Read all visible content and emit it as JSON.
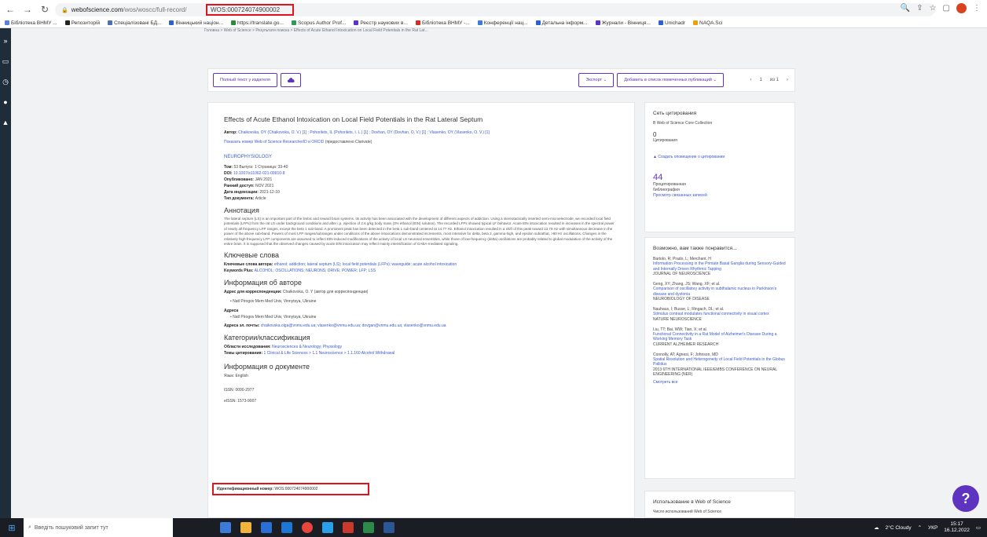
{
  "browser": {
    "url_host": "webofscience.com",
    "url_rest": "/wos/woscc/full-record/",
    "url_highlight": "WOS:000724074900002",
    "bookmarks": [
      "Бібліотека ВНМУ ...",
      "Репозиторій",
      "Спеціалізовані БД...",
      "Вінницький націон...",
      "https://translate.go...",
      "Scopus Author Prof...",
      "Реєстр наукових в...",
      "Бібліотека ВНМУ -...",
      "Конференції нац...",
      "Детальна інформ...",
      "Журнали - Вінниця...",
      "Unichadr",
      "NAQA.Sci"
    ]
  },
  "breadcrumb": "Головна > Web of Science > Результати поиска > Effects of Acute Ethanol Intoxication on Local Field Potentials in the Rat Lat...",
  "toolbar": {
    "full_text": "Полный текст у издателя",
    "export": "Экспорт ⌄",
    "add_to_list": "Добавить в список помеченных публикаций ⌄",
    "pager": [
      "‹",
      "1",
      "из 1",
      "›"
    ]
  },
  "record": {
    "title": "Effects of Acute Ethanol Intoxication on Local Field Potentials in the Rat Lateral Septum",
    "authors_label": "Автор:",
    "authors": "Chaikovska, OY (Chaikovska, O. V.) [1] ; Pohorilets, IL (Pohorilets, I. L.) [1] ; Dovhan, OY (Dovhan, O. V.) [1] ; Vlasenko, OY (Vlasenko, O. V.) [1]",
    "researcher_link": "Показать номер Web of Science ResearcherID и ORCID",
    "researcher_note": "(предоставлено Clarivate)",
    "journal": "NEUROPHYSIOLOGY",
    "meta": [
      {
        "k": "Том:",
        "v": "53  Выпуск: 1  Страница: 33-40"
      },
      {
        "k": "DOI:",
        "v": "10.1007/s11062-021-09910-8"
      },
      {
        "k": "Опубликовано:",
        "v": "JAN 2021"
      },
      {
        "k": "Ранний доступ:",
        "v": "NOV 2021"
      },
      {
        "k": "Дата индексации:",
        "v": "2021-12-10"
      },
      {
        "k": "Тип документа:",
        "v": "Article"
      }
    ],
    "abstract_h": "Аннотация",
    "abstract": "The lateral septum (LS) is an important part of the limbic and reward brain systems. Its activity has been associated with the development of different aspects of addiction. Using a stereotactically inserted semi-microelectrode, we recorded local field potentials (LFPs) from the rat LS under background conditions and after i.p. injection of 2.6 g/kg body mass (3% ethanol (EtN) solution). The recorded LFPs showed typical LF behavior. Acute EtN intoxication resulted in increases in the spectral power of nearly all frequency LFP ranges, except the beta 1 sub-band. A prominent peak has been detected in the beta 1 sub-band centered at 14.77 Hz. Ethanol intoxication resulted in a shift of this peak toward 13.79 Hz with simultaneous decrease in the power of the above sub-band. Powers of most LFP ranges/subranges under conditions of the above intoxications demonstrated increments, most intensive for delta, beta 2, gamma-high, and epsilon subrathat, >90 Hz oscillations. Changes in the relatively high-frequency LFP components are assumed to reflect EtN-induced modifications of the activity of local LS neuronal ensembles, while those of low-frequency (delta) oscillations are probably related to global modulation of the activity of the entire brain. It is supposed that the observed changes caused by acute EtN intoxication may reflect mainly intensification of GABA-mediated signaling.",
    "keywords_h": "Ключевые слова",
    "kw_author_label": "Ключевые слова автора:",
    "kw_author": "ethanol; addiction; lateral septum (LS); local field potentials (LFPs); waveguide; acute alcohol intoxication",
    "kw_plus_label": "Keywords Plus:",
    "kw_plus": "ALCOHOL; OSCILLATIONS; NEURONS; DRIVE; POWER; LFP; LSS",
    "author_info_h": "Информация об авторе",
    "corr_label": "Адрес для корреспонденции:",
    "corr": "Chaikovska, O. Y (автор для корреспонденции)",
    "corr_bullet": "Natl Pirogov Mem Med Univ, Vinnytsya, Ukraine",
    "addr_label": "Адреса",
    "addr_bullet": "Natl Pirogov Mem Med Univ, Vinnytsya, Ukraine",
    "email_label": "Адреса эл. почты:",
    "email": "chaikovska.olga@vnmu.edu.ua; vlasenko@vnmu.edu.ua; dovgan@vnmu.edu.ua; vlasenko@vnmu.edu.ua",
    "cat_h": "Категории/классификация",
    "area_label": "Области исследования:",
    "area": "Neurosciences & Neurology; Physiology",
    "topic_label": "Темы цитирования:",
    "topic": "1 Clinical & Life Sciences > 1.1 Neuroscience > 1.1.160 Alcohol Withdrawal",
    "doc_h": "Информация о документе",
    "lang": "Язык: English",
    "id_label": "Идентификационный номер:",
    "id": "WOS:000724074900002",
    "issn": "ISSN: 0090-2977",
    "eissn": "eISSN: 1573-9007"
  },
  "right": {
    "citnet_h": "Сеть цитирования",
    "citnet_src": "В Web of Science Core Collection",
    "cited_count": "0",
    "cited_label": "Цитирования",
    "alert": "Создать оповещение о цитировании",
    "refs_count": "44",
    "refs_l1": "Процитированная",
    "refs_l2": "библиография",
    "related": "Просмотр связанных записей",
    "also_h": "Возможно, вам также понравится...",
    "recs": [
      {
        "a": "Bartolo, R; Prado, L; Merchant, H",
        "t": "Information Processing in the Primate Basal Ganglia during Sensory-Guided and Internally Driven Rhythmic Tapping",
        "j": "JOURNAL OF NEUROSCIENCE"
      },
      {
        "a": "Geng, XY; Zhang, JS; Wang, XF; et al.",
        "t": "Comparison of oscillatory activity in subthalamic nucleus in Parkinson's disease and dystonia",
        "j": "NEUROBIOLOGY OF DISEASE"
      },
      {
        "a": "Nauhaus, I; Busse, L; Ringach, DL; et al.",
        "t": "Stimulus contrast modulates functional connectivity in visual cortex",
        "j": "NATURE NEUROSCIENCE"
      },
      {
        "a": "Liu, TT; Bai, WW; Tian, X; et al.",
        "t": "Functional Connectivity in a Rat Model of Alzheimer's Disease During a Working Memory Task",
        "j": "CURRENT ALZHEIMER RESEARCH"
      },
      {
        "a": "Connolly, AT; Agnesi, F; Johnson, MD",
        "t": "Spatial Resolution and Heterogeneity of Local Field Potentials in the Globus Pallidus",
        "j": "2013 6TH INTERNATIONAL IEEE/EMBS CONFERENCE ON NEURAL ENGINEERING (NER)"
      }
    ],
    "see_all": "Смотреть все",
    "usage_h": "Использование в Web of Science",
    "usage_t": "Число использований Web of Science"
  },
  "taskbar": {
    "search": "Введіть пошуковий запит тут",
    "weather": "2°C Cloudy",
    "lang": "УКР",
    "time": "15:17",
    "date": "16.12.2022"
  }
}
